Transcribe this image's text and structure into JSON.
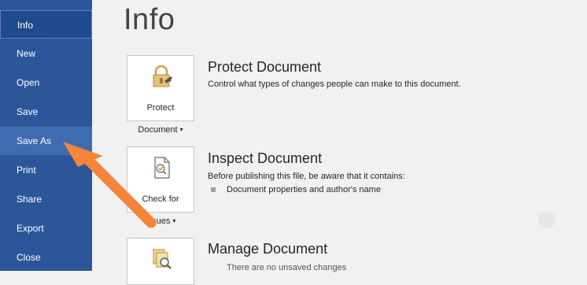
{
  "sidebar": {
    "items": [
      {
        "label": "Info",
        "state": "active"
      },
      {
        "label": "New",
        "state": ""
      },
      {
        "label": "Open",
        "state": ""
      },
      {
        "label": "Save",
        "state": ""
      },
      {
        "label": "Save As",
        "state": "hover"
      },
      {
        "label": "Print",
        "state": ""
      },
      {
        "label": "Share",
        "state": ""
      },
      {
        "label": "Export",
        "state": ""
      },
      {
        "label": "Close",
        "state": ""
      }
    ]
  },
  "main": {
    "title": "Info",
    "protect": {
      "button_label_1": "Protect",
      "button_label_2": "Document",
      "title": "Protect Document",
      "description": "Control what types of changes people can make to this document."
    },
    "inspect": {
      "button_label_1": "Check for",
      "button_label_2": "Issues",
      "title": "Inspect Document",
      "description": "Before publishing this file, be aware that it contains:",
      "bullet": "Document properties and author's name"
    },
    "manage": {
      "title": "Manage Document",
      "description": "There are no unsaved changes"
    }
  },
  "colors": {
    "sidebar_bg": "#2b579a",
    "annotation_arrow": "#f4853a"
  },
  "icons": {
    "protect": "lock-key-icon",
    "inspect": "document-check-icon",
    "manage": "document-search-icon"
  }
}
